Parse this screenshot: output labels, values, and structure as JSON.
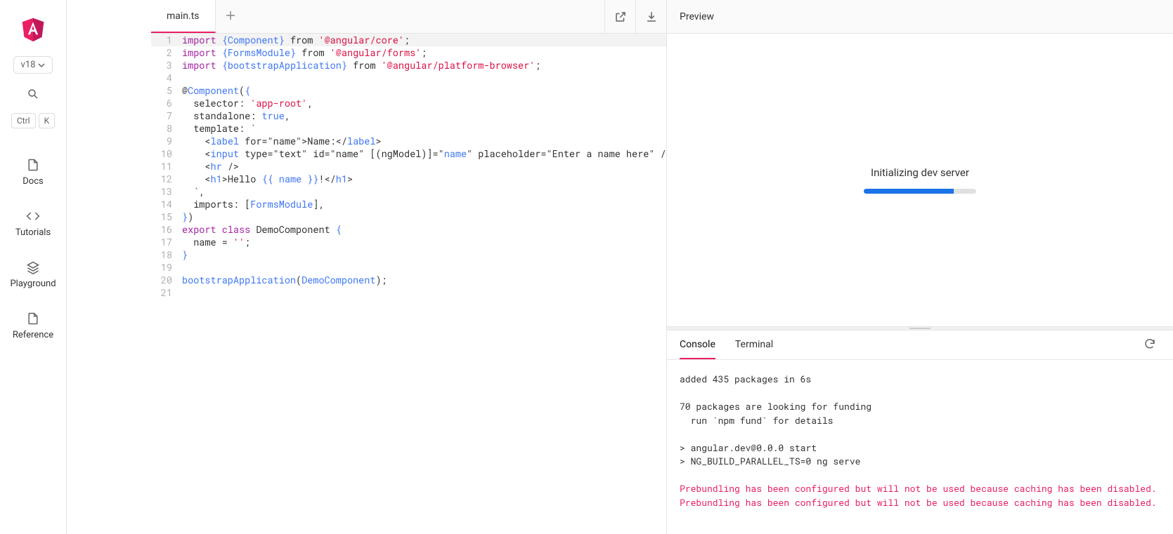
{
  "sidebar": {
    "version": "v18",
    "kbd1": "Ctrl",
    "kbd2": "K",
    "nav": [
      {
        "label": "Docs",
        "icon": "file"
      },
      {
        "label": "Tutorials",
        "icon": "code"
      },
      {
        "label": "Playground",
        "icon": "layers"
      },
      {
        "label": "Reference",
        "icon": "file"
      }
    ]
  },
  "editor": {
    "tab_label": "main.ts",
    "code_lines": [
      {
        "n": 1,
        "hl": true,
        "tokens": [
          [
            "kw",
            "import "
          ],
          [
            "brace",
            "{"
          ],
          [
            "type",
            "Component"
          ],
          [
            "brace",
            "}"
          ],
          [
            "punc",
            " from "
          ],
          [
            "str",
            "'@angular/core'"
          ],
          [
            "punc",
            ";"
          ]
        ]
      },
      {
        "n": 2,
        "tokens": [
          [
            "kw",
            "import "
          ],
          [
            "brace",
            "{"
          ],
          [
            "type",
            "FormsModule"
          ],
          [
            "brace",
            "}"
          ],
          [
            "punc",
            " from "
          ],
          [
            "str",
            "'@angular/forms'"
          ],
          [
            "punc",
            ";"
          ]
        ]
      },
      {
        "n": 3,
        "tokens": [
          [
            "kw",
            "import "
          ],
          [
            "brace",
            "{"
          ],
          [
            "type",
            "bootstrapApplication"
          ],
          [
            "brace",
            "}"
          ],
          [
            "punc",
            " from "
          ],
          [
            "str",
            "'@angular/platform-browser'"
          ],
          [
            "punc",
            ";"
          ]
        ]
      },
      {
        "n": 4,
        "tokens": [
          [
            "",
            ""
          ]
        ]
      },
      {
        "n": 5,
        "tokens": [
          [
            "punc",
            "@"
          ],
          [
            "type",
            "Component"
          ],
          [
            "punc",
            "("
          ],
          [
            "brace",
            "{"
          ]
        ]
      },
      {
        "n": 6,
        "tokens": [
          [
            "punc",
            "  selector: "
          ],
          [
            "str",
            "'app-root'"
          ],
          [
            "punc",
            ","
          ]
        ]
      },
      {
        "n": 7,
        "tokens": [
          [
            "punc",
            "  standalone: "
          ],
          [
            "num",
            "true"
          ],
          [
            "punc",
            ","
          ]
        ]
      },
      {
        "n": 8,
        "tokens": [
          [
            "punc",
            "  template: `"
          ]
        ]
      },
      {
        "n": 9,
        "tokens": [
          [
            "punc",
            "    <"
          ],
          [
            "type",
            "label"
          ],
          [
            "punc",
            " for=\"name\">Name:</"
          ],
          [
            "type",
            "label"
          ],
          [
            "punc",
            ">"
          ]
        ]
      },
      {
        "n": 10,
        "tokens": [
          [
            "punc",
            "    <"
          ],
          [
            "type",
            "input"
          ],
          [
            "punc",
            " type=\"text\" id=\"name\" [(ngModel)]=\""
          ],
          [
            "type",
            "name"
          ],
          [
            "punc",
            "\" placeholder=\"Enter a name here\" />"
          ]
        ]
      },
      {
        "n": 11,
        "tokens": [
          [
            "punc",
            "    <"
          ],
          [
            "type",
            "hr"
          ],
          [
            "punc",
            " />"
          ]
        ]
      },
      {
        "n": 12,
        "tokens": [
          [
            "punc",
            "    <"
          ],
          [
            "type",
            "h1"
          ],
          [
            "punc",
            ">Hello "
          ],
          [
            "brace",
            "{{ "
          ],
          [
            "type",
            "name"
          ],
          [
            "brace",
            " }}"
          ],
          [
            "punc",
            "!</"
          ],
          [
            "type",
            "h1"
          ],
          [
            "punc",
            ">"
          ]
        ]
      },
      {
        "n": 13,
        "tokens": [
          [
            "punc",
            "  `,"
          ]
        ]
      },
      {
        "n": 14,
        "tokens": [
          [
            "punc",
            "  imports: ["
          ],
          [
            "type",
            "FormsModule"
          ],
          [
            "punc",
            "],"
          ]
        ]
      },
      {
        "n": 15,
        "tokens": [
          [
            "brace",
            "}"
          ],
          [
            "punc",
            ")"
          ]
        ]
      },
      {
        "n": 16,
        "tokens": [
          [
            "kw",
            "export "
          ],
          [
            "kw",
            "class "
          ],
          [
            "punc",
            "DemoComponent "
          ],
          [
            "brace",
            "{"
          ]
        ]
      },
      {
        "n": 17,
        "tokens": [
          [
            "punc",
            "  name = "
          ],
          [
            "str",
            "''"
          ],
          [
            "punc",
            ";"
          ]
        ]
      },
      {
        "n": 18,
        "tokens": [
          [
            "brace",
            "}"
          ]
        ]
      },
      {
        "n": 19,
        "tokens": [
          [
            "",
            ""
          ]
        ]
      },
      {
        "n": 20,
        "tokens": [
          [
            "fn",
            "bootstrapApplication"
          ],
          [
            "punc",
            "("
          ],
          [
            "type",
            "DemoComponent"
          ],
          [
            "punc",
            ");"
          ]
        ]
      },
      {
        "n": 21,
        "tokens": [
          [
            "",
            ""
          ]
        ]
      }
    ]
  },
  "preview": {
    "title": "Preview",
    "status_text": "Initializing dev server",
    "progress_pct": 80
  },
  "console": {
    "tabs": [
      "Console",
      "Terminal"
    ],
    "active_index": 0,
    "lines": [
      {
        "text": "added 435 packages in 6s"
      },
      {
        "text": ""
      },
      {
        "text": "70 packages are looking for funding"
      },
      {
        "text": "  run `npm fund` for details"
      },
      {
        "text": ""
      },
      {
        "text": "> angular.dev@0.0.0 start"
      },
      {
        "text": "> NG_BUILD_PARALLEL_TS=0 ng serve"
      },
      {
        "text": ""
      },
      {
        "text": "Prebundling has been configured but will not be used because caching has been disabled.",
        "warn": true
      },
      {
        "text": "Prebundling has been configured but will not be used because caching has been disabled.",
        "warn": true
      }
    ]
  }
}
